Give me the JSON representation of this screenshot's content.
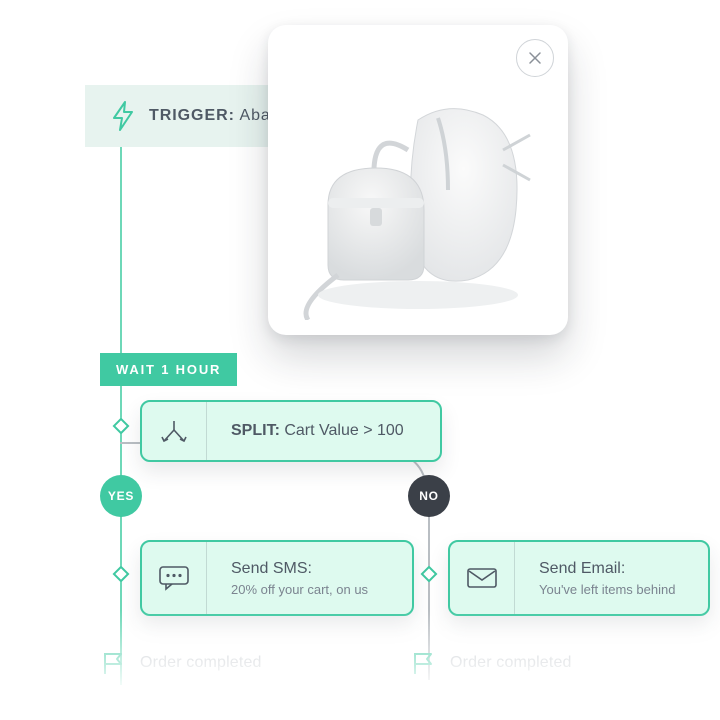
{
  "trigger": {
    "prefix": "TRIGGER:",
    "label": "Abandoned Cart"
  },
  "wait": {
    "label": "WAIT 1 HOUR"
  },
  "split": {
    "prefix": "SPLIT:",
    "label": "Cart Value > 100",
    "yes": "YES",
    "no": "NO",
    "icon": "split-icon"
  },
  "actions": {
    "sms": {
      "title": "Send SMS:",
      "subtitle": "20% off your cart, on us",
      "icon": "sms-icon"
    },
    "email": {
      "title": "Send Email:",
      "subtitle": "You've left items behind",
      "icon": "mail-icon"
    }
  },
  "terminal": {
    "label": "Order completed",
    "icon": "flag-icon"
  },
  "photo": {
    "close_icon": "close-icon",
    "subject": "handbags"
  },
  "colors": {
    "accent": "#40c9a2",
    "slate": "#4f5965"
  }
}
